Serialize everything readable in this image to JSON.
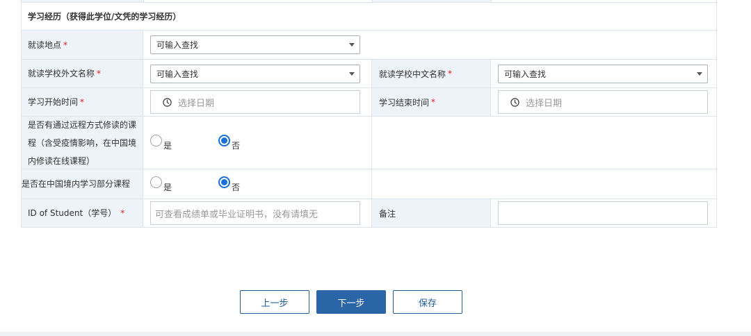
{
  "section_title": "学习经历（获得此学位/文凭的学习经历）",
  "fields": {
    "location": {
      "label": "就读地点",
      "required_mark": "*",
      "value": "可输入查找"
    },
    "school_foreign": {
      "label": "就读学校外文名称",
      "required_mark": "*",
      "value": "可输入查找"
    },
    "school_chinese": {
      "label": "就读学校中文名称",
      "required_mark": "*",
      "value": "可输入查找"
    },
    "start_date": {
      "label": "学习开始时间",
      "required_mark": "*",
      "placeholder": "选择日期"
    },
    "end_date": {
      "label": "学习结束时间",
      "required_mark": "*",
      "placeholder": "选择日期"
    },
    "remote": {
      "label": "是否有通过远程方式修读的课程（含受疫情影响，在中国境内修读在线课程）",
      "yes": "是",
      "no": "否",
      "selected": "否"
    },
    "in_china": {
      "label": "是否在中国境内学习部分课程",
      "yes": "是",
      "no": "否",
      "selected": "否"
    },
    "student_id": {
      "label": "ID of Student（学号）",
      "required_mark": "*",
      "placeholder": "可查看成绩单或毕业证明书，没有请填无"
    },
    "remark": {
      "label": "备注",
      "value": ""
    }
  },
  "buttons": {
    "prev": "上一步",
    "next": "下一步",
    "save": "保存"
  },
  "colors": {
    "label_bg": "#eef3f9",
    "border": "#dde3ea",
    "primary": "#2a65a8",
    "required": "#e02020",
    "radio_on": "#1a6fd8"
  }
}
